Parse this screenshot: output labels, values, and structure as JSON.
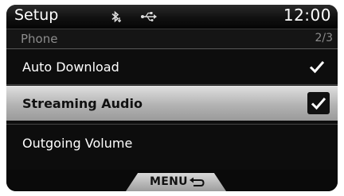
{
  "statusbar": {
    "title": "Setup",
    "bluetooth_icon": "bluetooth-icon",
    "usb_icon": "usb-icon",
    "time": "12:00"
  },
  "subheader": {
    "section": "Phone",
    "page": "2/3"
  },
  "menu": {
    "items": [
      {
        "label": "Auto Download",
        "checked": true,
        "selected": false
      },
      {
        "label": "Streaming Audio",
        "checked": true,
        "selected": true
      },
      {
        "label": "Outgoing Volume",
        "checked": false,
        "selected": false
      }
    ]
  },
  "bottombar": {
    "menu_label": "MENU",
    "return_icon": "return-arrow-icon"
  }
}
